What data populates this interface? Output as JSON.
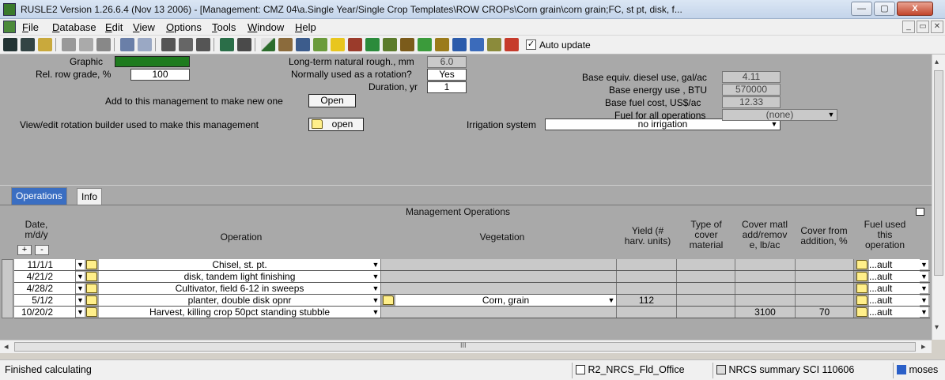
{
  "window": {
    "title": "RUSLE2 Version 1.26.6.4 (Nov 13 2006) - [Management:  CMZ 04\\a.Single Year/Single Crop Templates\\ROW CROPs\\Corn grain\\corn grain;FC, st pt, disk, f...",
    "minimize": "—",
    "maximize": "▢",
    "close": "X"
  },
  "menu": [
    "File",
    "Database",
    "Edit",
    "View",
    "Options",
    "Tools",
    "Window",
    "Help"
  ],
  "menu_hotkeys": [
    "F",
    "D",
    "E",
    "V",
    "O",
    "T",
    "W",
    "H"
  ],
  "mdi_controls": {
    "minimize": "_",
    "restore": "▭",
    "close": "✕"
  },
  "toolbar": {
    "auto_update_label": "Auto update",
    "auto_update_checked": "✓",
    "icons": [
      "save-icon",
      "save-all-icon",
      "link-icon",
      "cut-icon",
      "copy-icon",
      "paste-icon",
      "undo-icon",
      "redo-icon",
      "parameter-icon",
      "parameter-2-icon",
      "parameter-3-icon",
      "refresh-icon",
      "table-icon",
      "slope-icon",
      "soil-profile-icon",
      "rain-icon",
      "grass-icon",
      "container-icon",
      "building-icon",
      "tree-icon",
      "crop-icon",
      "field-icon",
      "vegetation-icon",
      "residue-icon",
      "map-icon",
      "report-icon",
      "profile-icon",
      "erosion-icon"
    ]
  },
  "form": {
    "graphic_label": "Graphic",
    "graphic_color": "#1e7b1e",
    "row_grade_label": "Rel. row grade, %",
    "row_grade_value": "100",
    "roughness_label": "Long-term natural rough., mm",
    "roughness_value": "6.0",
    "rotation_label": "Normally used as a rotation?",
    "rotation_value": "Yes",
    "duration_label": "Duration, yr",
    "duration_value": "1",
    "add_label": "Add to this management to make new one",
    "add_button": "Open",
    "rotation_builder_label": "View/edit rotation builder used to make this management",
    "rotation_builder_button": "open",
    "irrigation_label": "Irrigation system",
    "irrigation_value": "no irrigation",
    "diesel_label": "Base equiv. diesel use, gal/ac",
    "diesel_value": "4.11",
    "energy_label": "Base energy use , BTU",
    "energy_value": "570000",
    "fuel_cost_label": "Base fuel cost, US$/ac",
    "fuel_cost_value": "12.33",
    "fuel_all_label": "Fuel for all operations",
    "fuel_all_value": "(none)"
  },
  "tabs": [
    {
      "label": "Operations",
      "active": true
    },
    {
      "label": "Info",
      "active": false
    }
  ],
  "grid": {
    "title": "Management Operations",
    "headers": {
      "date": "Date,\nm/d/y",
      "date_plus": "+",
      "date_minus": "-",
      "operation": "Operation",
      "vegetation": "Vegetation",
      "yield": "Yield (#\nharv. units)",
      "cover_type": "Type of\ncover\nmaterial",
      "cover_add": "Cover matl\nadd/remov\ne, lb/ac",
      "cover_pct": "Cover from\naddition, %",
      "fuel": "Fuel used\nthis\noperation"
    },
    "rows": [
      {
        "date": "11/1/1",
        "operation": "Chisel, st. pt.",
        "vegetation": "",
        "yield": "",
        "cover_type": "",
        "cover_add": "",
        "cover_pct": "",
        "fuel": "...ault"
      },
      {
        "date": "4/21/2",
        "operation": "disk, tandem light finishing",
        "vegetation": "",
        "yield": "",
        "cover_type": "",
        "cover_add": "",
        "cover_pct": "",
        "fuel": "...ault"
      },
      {
        "date": "4/28/2",
        "operation": "Cultivator, field 6-12 in sweeps",
        "vegetation": "",
        "yield": "",
        "cover_type": "",
        "cover_add": "",
        "cover_pct": "",
        "fuel": "...ault"
      },
      {
        "date": "5/1/2",
        "operation": "planter, double disk opnr",
        "vegetation": "Corn, grain",
        "yield": "112",
        "cover_type": "",
        "cover_add": "",
        "cover_pct": "",
        "fuel": "...ault"
      },
      {
        "date": "10/20/2",
        "operation": "Harvest, killing crop 50pct standing stubble",
        "vegetation": "",
        "yield": "",
        "cover_type": "",
        "cover_add": "3100",
        "cover_pct": "70",
        "fuel": "...ault"
      }
    ]
  },
  "scroll": {
    "left": "◂",
    "right": "▸",
    "up": "▴",
    "down": "▾",
    "grip": "III"
  },
  "status": {
    "message": "Finished calculating",
    "database": "R2_NRCS_Fld_Office",
    "template": "NRCS summary SCI 110606",
    "user": "moses"
  }
}
